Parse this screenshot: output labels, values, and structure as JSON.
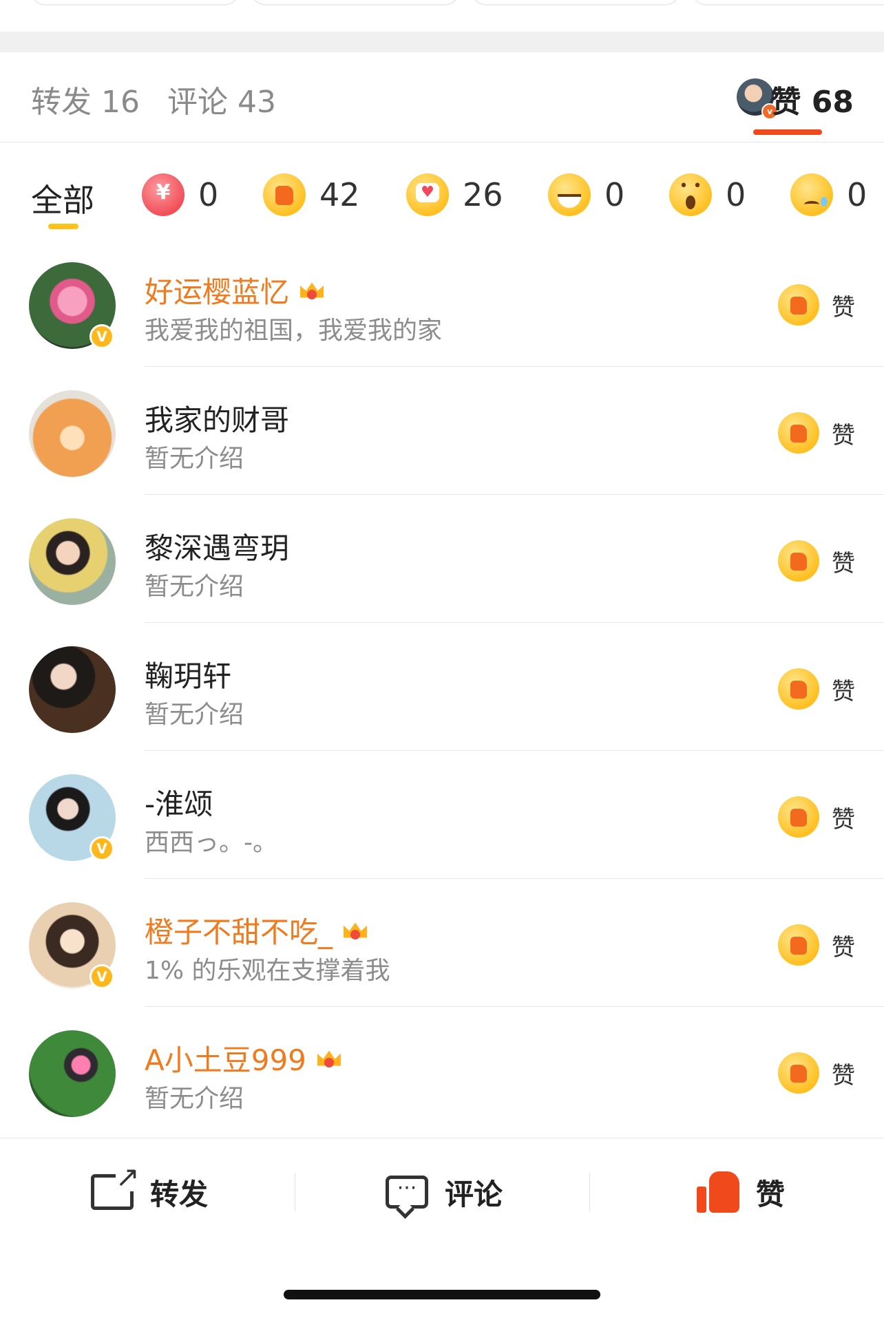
{
  "header": {
    "repost": "转发 16",
    "comment": "评论 43",
    "like": "赞 68"
  },
  "filters": {
    "all": "全部",
    "items": [
      {
        "icon": "heart-yuan-icon",
        "count": "0"
      },
      {
        "icon": "thumbs-up-icon",
        "count": "42"
      },
      {
        "icon": "heart-bubble-icon",
        "count": "26"
      },
      {
        "icon": "grin-icon",
        "count": "0"
      },
      {
        "icon": "surprised-icon",
        "count": "0"
      },
      {
        "icon": "sad-icon",
        "count": "0"
      }
    ]
  },
  "users": [
    {
      "name": "好运樱蓝忆",
      "bio": "我爱我的祖国，我爱我的家",
      "vip": true,
      "verified": true
    },
    {
      "name": "我家的财哥",
      "bio": "暂无介绍",
      "vip": false,
      "verified": false
    },
    {
      "name": "黎深遇弯玥",
      "bio": "暂无介绍",
      "vip": false,
      "verified": false
    },
    {
      "name": "鞠玥轩",
      "bio": "暂无介绍",
      "vip": false,
      "verified": false
    },
    {
      "name": "-淮颂",
      "bio": "西西っ。-。",
      "vip": false,
      "verified": true
    },
    {
      "name": "橙子不甜不吃_",
      "bio": "1% 的乐观在支撑着我",
      "vip": true,
      "verified": true
    },
    {
      "name": "A小土豆999",
      "bio": "暂无介绍",
      "vip": true,
      "verified": false
    }
  ],
  "row_like_label": "赞",
  "actions": {
    "repost": "转发",
    "comment": "评论",
    "like": "赞"
  },
  "colors": {
    "accent": "#f04a1c",
    "vip_name": "#f07a1e",
    "filter_underline": "#ffc21a"
  }
}
